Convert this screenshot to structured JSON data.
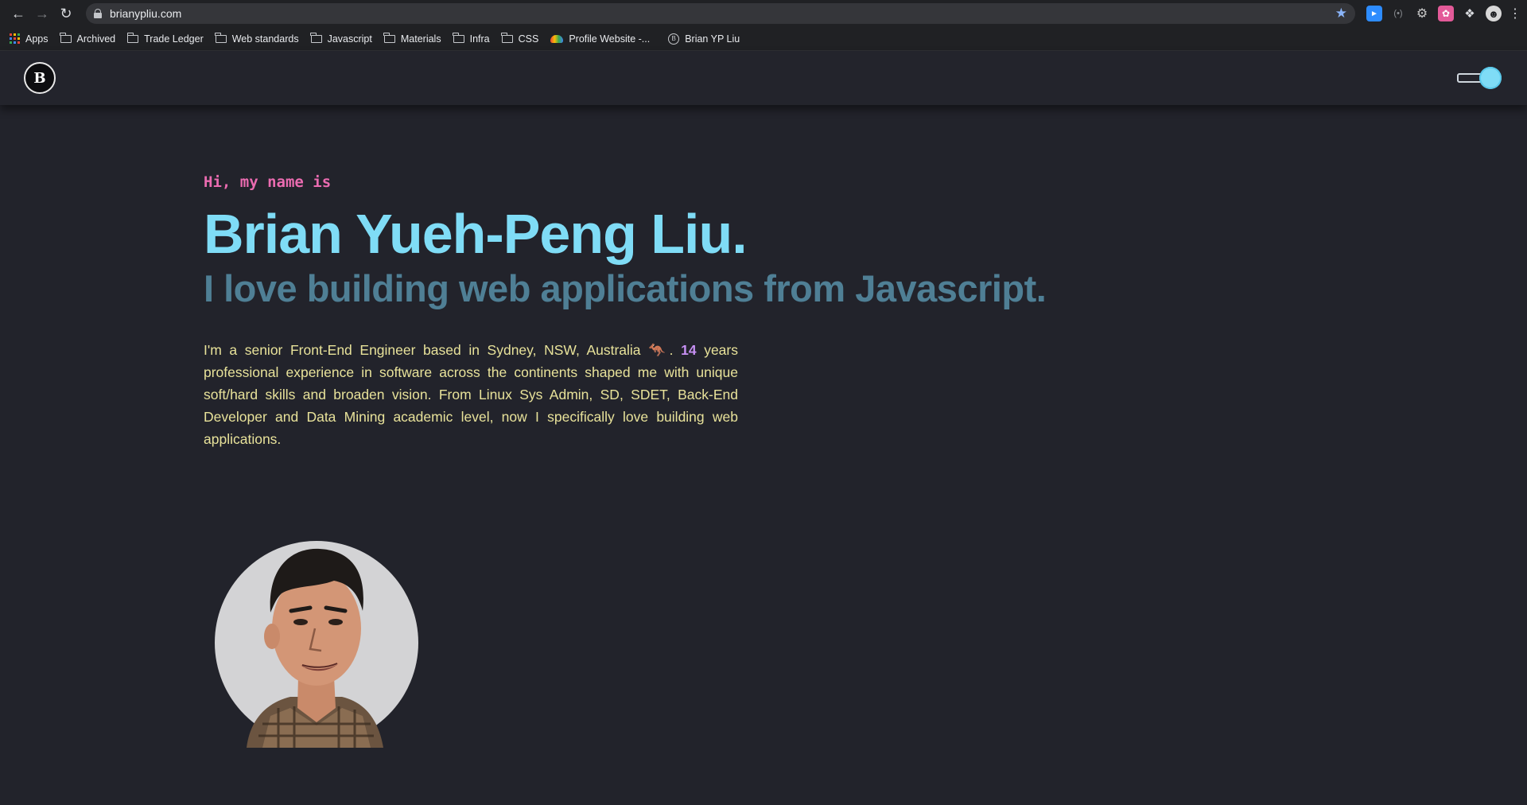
{
  "browser": {
    "url": "brianypliu.com",
    "bookmarks": [
      {
        "label": "Apps",
        "icon": "apps-grid-icon"
      },
      {
        "label": "Archived",
        "icon": "folder-icon"
      },
      {
        "label": "Trade Ledger",
        "icon": "folder-icon"
      },
      {
        "label": "Web standards",
        "icon": "folder-icon"
      },
      {
        "label": "Javascript",
        "icon": "folder-icon"
      },
      {
        "label": "Materials",
        "icon": "folder-icon"
      },
      {
        "label": "Infra",
        "icon": "folder-icon"
      },
      {
        "label": "CSS",
        "icon": "folder-icon"
      },
      {
        "label": "Profile Website -...",
        "icon": "cloud-icon"
      },
      {
        "label": "Brian YP Liu",
        "icon": "site-logo-icon"
      }
    ]
  },
  "site": {
    "logo_text": "B",
    "greeting": "Hi, my name is",
    "name": "Brian Yueh-Peng Liu.",
    "tagline": "I love building web applications from Javascript.",
    "bio_start": "I'm a senior Front-End Engineer based in Sydney, NSW, Australia 🦘. ",
    "bio_years": "14",
    "bio_end": " years professional experience in software across the continents shaped me with unique soft/hard skills and broaden vision. From Linux Sys Admin, SD, SDET, Back-End Developer and Data Mining academic level, now I specifically love building web applications."
  },
  "colors": {
    "background": "#22232b",
    "name": "#7fdcf6",
    "tagline": "#4f7f95",
    "greeting": "#ea6bb0",
    "bio": "#e8e29a",
    "years": "#c790f4"
  }
}
